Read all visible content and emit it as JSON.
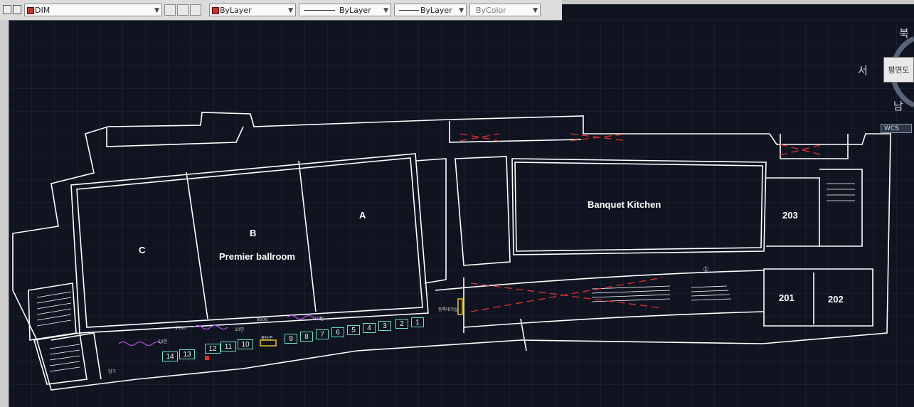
{
  "toolbar": {
    "layer_name": "DIM",
    "color_value": "ByLayer",
    "linetype_value": "ByLayer",
    "lineweight_value": "ByLayer",
    "plotstyle_value": "ByColor"
  },
  "viewcube": {
    "north": "북",
    "west": "서",
    "south": "남",
    "face_label": "평면도",
    "wcs_label": "WCS"
  },
  "floorplan": {
    "rooms": {
      "section_c": "C",
      "section_b": "B",
      "section_a": "A",
      "ballroom": "Premier ballroom",
      "kitchen": "Banquet Kitchen",
      "room_203": "203",
      "room_201": "201",
      "room_202": "202"
    },
    "booths": [
      "1",
      "2",
      "3",
      "4",
      "5",
      "6",
      "7",
      "8",
      "9",
      "10",
      "11",
      "12",
      "13",
      "14"
    ],
    "small_labels": {
      "width_1": "9500",
      "width_2": "9500",
      "count_1": "10인",
      "count_2": "10인",
      "count_3": "10인",
      "registration": "등록대기실",
      "info": "홍보존",
      "entrance": "입구",
      "marker": "①"
    }
  },
  "colors": {
    "background": "#0f1420",
    "walls": "#ffffff",
    "grid": "#1f2a3c",
    "booth_outline": "#6ee0c0",
    "hatch_red": "#e03030",
    "cable_purple": "#b050e0",
    "marker_yellow": "#e8c020"
  }
}
